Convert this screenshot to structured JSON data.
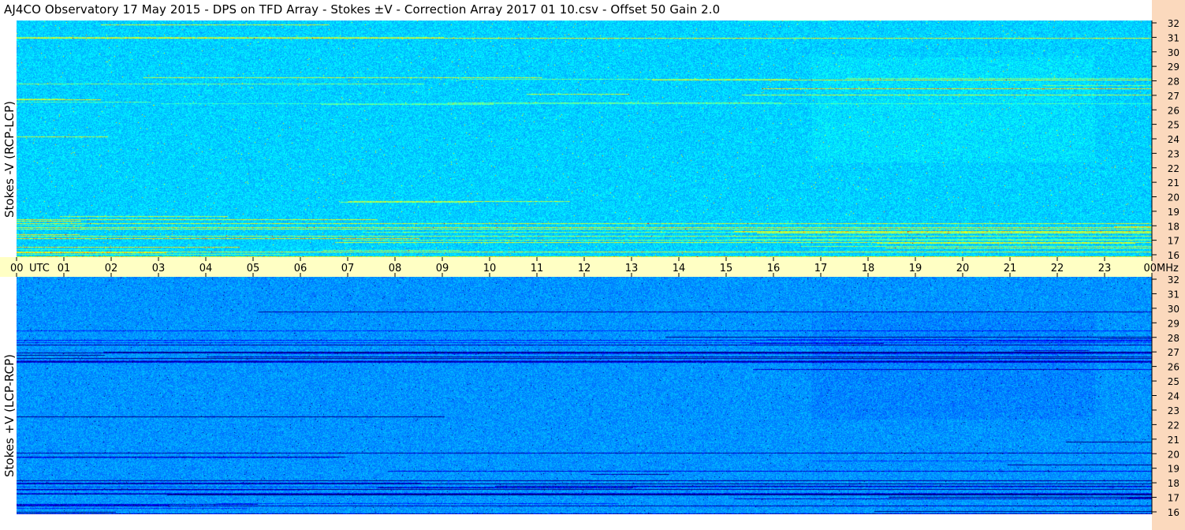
{
  "window": {
    "title": "AJ4CO Observatory  17 May 2015  -  DPS on TFD Array  -  Stokes ±V  -  Correction Array 2017 01 10.csv  -  Offset 50  Gain 2.0"
  },
  "colors": {
    "frequency_axis_strip": "#fbd9bd",
    "time_axis_bar": "#ffffc4",
    "top_panel_base": "#1a8fe6",
    "bottom_panel_base": "#1a55d6"
  },
  "chart_data": [
    {
      "type": "heatmap",
      "panel": "top",
      "title": "AJ4CO Observatory  17 May 2015  -  DPS on TFD Array  -  Stokes ±V  -  Correction Array 2017 01 10.csv  -  Offset 50  Gain 2.0",
      "ylabel": "Stokes -V (RCP-LCP)",
      "xlabel": "UTC",
      "x_ticks": [
        "00",
        "01",
        "02",
        "03",
        "04",
        "05",
        "06",
        "07",
        "08",
        "09",
        "10",
        "11",
        "12",
        "13",
        "14",
        "15",
        "16",
        "17",
        "18",
        "19",
        "20",
        "21",
        "22",
        "23",
        "00"
      ],
      "x_range_utc_hours": [
        0,
        24
      ],
      "y_unit": "MHz",
      "y_ticks": [
        32,
        31,
        30,
        29,
        28,
        27,
        26,
        25,
        24,
        23,
        22,
        21,
        20,
        19,
        18,
        17,
        16
      ],
      "y_range_mhz": [
        16,
        32
      ],
      "colormap": "jet-like (dark blue, blue, cyan, yellow, red)",
      "notes": "predominantly medium blue background with bright horizontal interference lines, strongest near 16-18 MHz and 26-28 MHz"
    },
    {
      "type": "heatmap",
      "panel": "bottom",
      "ylabel": "Stokes +V (LCP-RCP)",
      "xlabel": "UTC",
      "x_ticks": [
        "00",
        "01",
        "02",
        "03",
        "04",
        "05",
        "06",
        "07",
        "08",
        "09",
        "10",
        "11",
        "12",
        "13",
        "14",
        "15",
        "16",
        "17",
        "18",
        "19",
        "20",
        "21",
        "22",
        "23",
        "00"
      ],
      "x_range_utc_hours": [
        0,
        24
      ],
      "y_unit": "MHz",
      "y_ticks": [
        32,
        31,
        30,
        29,
        28,
        27,
        26,
        25,
        24,
        23,
        22,
        21,
        20,
        19,
        18,
        17,
        16
      ],
      "y_range_mhz": [
        16,
        32
      ],
      "colormap": "jet-like (dark blue, blue, cyan, yellow, red)",
      "notes": "predominantly darker blue background with dark horizontal interference lines, strongest near 16-18 MHz and 26-28 MHz"
    }
  ],
  "time_axis": {
    "start_label": "00",
    "utc_label": "UTC",
    "end_label": "00",
    "mhz_label": "MHz"
  },
  "top_ylabel": "Stokes -V (RCP-LCP)",
  "bottom_ylabel": "Stokes +V (LCP-RCP)"
}
